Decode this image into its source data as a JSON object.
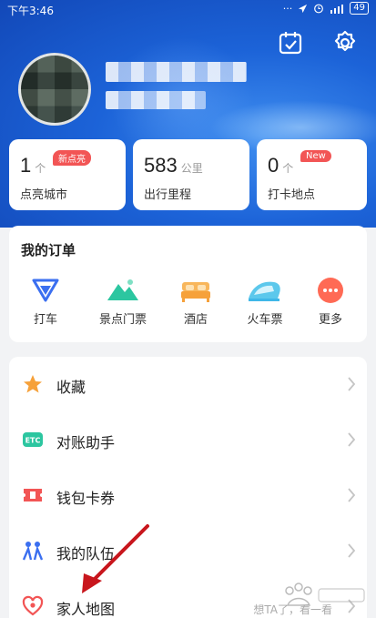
{
  "status_bar": {
    "time": "下午3:46",
    "battery": "49"
  },
  "stats": [
    {
      "value": "1",
      "unit": "个",
      "label": "点亮城市",
      "badge": "新点亮"
    },
    {
      "value": "583",
      "unit": "公里",
      "label": "出行里程",
      "badge": ""
    },
    {
      "value": "0",
      "unit": "个",
      "label": "打卡地点",
      "badge": "New"
    }
  ],
  "orders": {
    "title": "我的订单",
    "items": [
      {
        "label": "打车",
        "icon": "taxi-icon",
        "color": "#3b6ff0"
      },
      {
        "label": "景点门票",
        "icon": "mountain-icon",
        "color": "#2cc6a0"
      },
      {
        "label": "酒店",
        "icon": "bed-icon",
        "color": "#f6a13a"
      },
      {
        "label": "火车票",
        "icon": "train-icon",
        "color": "#3fb7e8"
      },
      {
        "label": "更多",
        "icon": "more-icon",
        "color": "#ff6a55"
      }
    ]
  },
  "menu": [
    {
      "label": "收藏",
      "icon": "star-icon",
      "sub": ""
    },
    {
      "label": "对账助手",
      "icon": "etc-icon",
      "icon_text": "ETC",
      "sub": ""
    },
    {
      "label": "钱包卡券",
      "icon": "ticket-icon",
      "sub": ""
    },
    {
      "label": "我的队伍",
      "icon": "team-icon",
      "sub": ""
    },
    {
      "label": "家人地图",
      "icon": "family-heart-icon",
      "sub": "想TA了，看一看"
    }
  ],
  "colors": {
    "accent": "#2a6be0",
    "badge_red": "#f25555",
    "arrow": "#c8161d"
  }
}
